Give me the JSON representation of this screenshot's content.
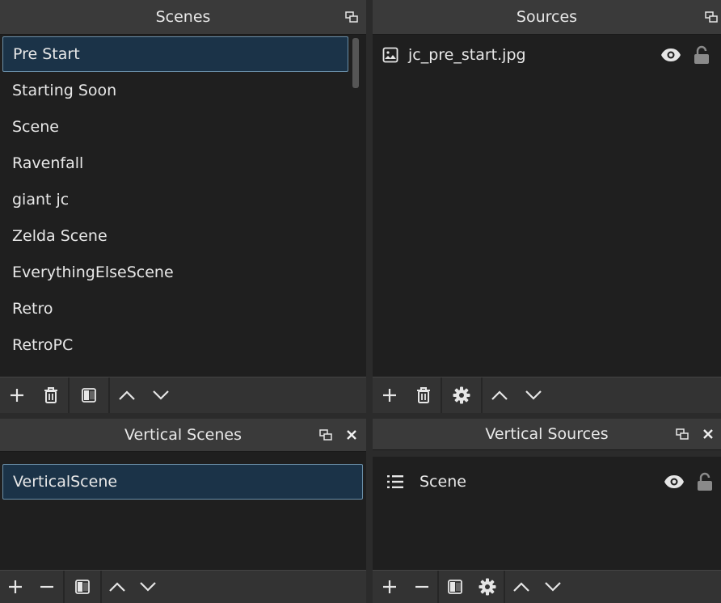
{
  "scenes": {
    "title": "Scenes",
    "items": [
      {
        "label": "Pre Start",
        "selected": true
      },
      {
        "label": "Starting Soon"
      },
      {
        "label": "Scene"
      },
      {
        "label": "Ravenfall"
      },
      {
        "label": "giant jc"
      },
      {
        "label": "Zelda Scene"
      },
      {
        "label": "EverythingElseScene"
      },
      {
        "label": "Retro"
      },
      {
        "label": "RetroPC"
      }
    ]
  },
  "sources": {
    "title": "Sources",
    "items": [
      {
        "label": "jc_pre_start.jpg",
        "icon": "image-icon",
        "visible": true,
        "locked": false
      }
    ]
  },
  "vertical_scenes": {
    "title": "Vertical Scenes",
    "items": [
      {
        "label": "VerticalScene",
        "selected": true
      }
    ]
  },
  "vertical_sources": {
    "title": "Vertical Sources",
    "items": [
      {
        "label": "Scene",
        "icon": "list-icon",
        "visible": true,
        "locked": false
      }
    ]
  },
  "colors": {
    "panel_bg": "#1f1f1f",
    "header_bg": "#3a3a3a",
    "toolbar_bg": "#333333",
    "selection_bg": "#1b3348",
    "selection_border": "#6b8fa8"
  }
}
